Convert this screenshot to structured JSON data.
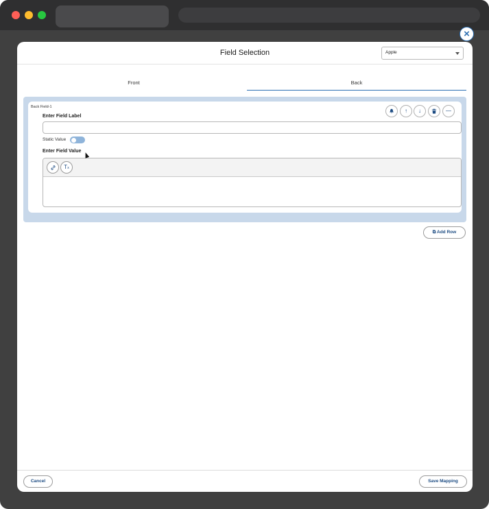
{
  "modal": {
    "title": "Field Selection",
    "object_select": {
      "value": "Apple"
    }
  },
  "tabs": [
    {
      "label": "Front",
      "active": false
    },
    {
      "label": "Back",
      "active": true
    }
  ],
  "field": {
    "id": "Back Field-1",
    "label_heading": "Enter Field Label",
    "label_value": "",
    "static_value_label": "Static Value",
    "static_value_on": false,
    "value_heading": "Enter Field Value",
    "action_icons": [
      "bell-icon",
      "arrow-up-icon",
      "arrow-down-icon",
      "trash-icon",
      "minus-icon"
    ],
    "editor_icons": [
      "link-icon",
      "clear-format-icon"
    ]
  },
  "actions": {
    "add_row": "Add Row",
    "cancel": "Cancel",
    "save": "Save Mapping"
  },
  "colors": {
    "accent": "#2c6fb3",
    "panel": "#c8d8ea",
    "toggle": "#8fb4da"
  }
}
